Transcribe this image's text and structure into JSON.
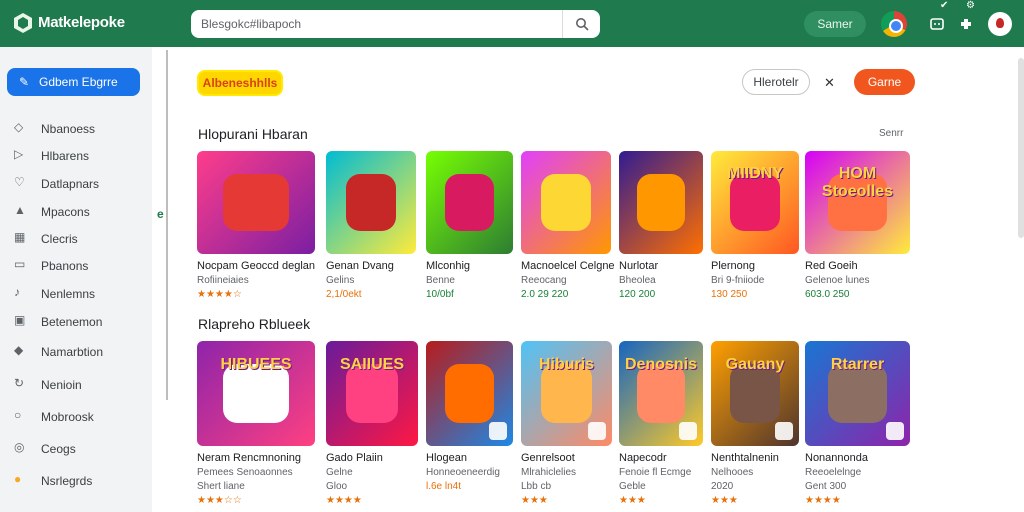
{
  "header": {
    "app_title": "Matkelepoke",
    "search_placeholder": "Blesgokc#libapoch",
    "sign_in": "Samer",
    "icons": [
      "search-icon",
      "chrome-icon",
      "extension-icon",
      "puzzle-icon",
      "avatar"
    ],
    "top_right_glyphs": [
      "✔",
      "⚙"
    ]
  },
  "sidebar": {
    "primary": "Gdbem Ebgrre",
    "items": [
      {
        "label": "Nbanoess",
        "icon": "tag-icon"
      },
      {
        "label": "Hlbarens",
        "icon": "play-icon"
      },
      {
        "label": "Datlapnars",
        "icon": "heart-icon"
      },
      {
        "label": "Mpacons",
        "icon": "mountain-icon"
      },
      {
        "label": "Clecris",
        "icon": "grid-icon"
      },
      {
        "label": "Pbanons",
        "icon": "book-icon"
      },
      {
        "label": "Nenlemns",
        "icon": "music-icon"
      },
      {
        "label": "Betenemon",
        "icon": "image-icon"
      },
      {
        "label": "Namarbtion",
        "icon": "tag-filled-icon"
      },
      {
        "label": "Nenioin",
        "icon": "refresh-icon"
      },
      {
        "label": "Mobroosk",
        "icon": "bulb-icon"
      },
      {
        "label": "Ceogs",
        "icon": "circle-icon"
      },
      {
        "label": "Nsrlegrds",
        "icon": "emoji-icon"
      }
    ]
  },
  "main": {
    "brand_badge": "Albeneshhlls",
    "outline_button": "Hlerotelr",
    "action_button": "Garne",
    "sections": [
      {
        "title": "Hlopurani Hbaran",
        "see_more": "Senrr",
        "cards": [
          {
            "title": "Nocpam Geoccd deglan",
            "sub": "Rofiineiaies",
            "meta": "★★★★☆",
            "meta_color": "orange",
            "bg": [
              "#ff3d8b",
              "#7b1fa2"
            ],
            "art": "#e53935"
          },
          {
            "title": "Genan Dvang",
            "sub": "Gelins",
            "meta": "2,1/0ekt",
            "meta_color": "orange",
            "bg": [
              "#00bcd4",
              "#ffeb3b"
            ],
            "art": "#c62828"
          },
          {
            "title": "Mlconhig",
            "sub": "Benne",
            "meta": "10/0bf",
            "meta_color": "green",
            "bg": [
              "#76ff03",
              "#2e7d32"
            ],
            "art": "#d81b60"
          },
          {
            "title": "Macnoelcel Celgne",
            "sub": "Reeocang",
            "meta": "2.0 29 220",
            "meta_color": "green",
            "bg": [
              "#e040fb",
              "#ff9800"
            ],
            "art": "#fdd835"
          },
          {
            "title": "Nurlotar",
            "sub": "Bheolea",
            "meta": "120 200",
            "meta_color": "green",
            "bg": [
              "#311b92",
              "#ff6f00"
            ],
            "art": "#ff9800"
          },
          {
            "title": "Plernong",
            "sub": "Bri 9-fniiode",
            "meta": "130 250",
            "meta_color": "orange",
            "bg": [
              "#ffeb3b",
              "#ff5722"
            ],
            "art": "#e91e63",
            "label": "MIIDNY"
          },
          {
            "title": "Red Goeih",
            "sub": "Gelenoe lunes",
            "meta": "603.0 250",
            "meta_color": "green",
            "bg": [
              "#d500f9",
              "#ffeb3b"
            ],
            "art": "#ff7043",
            "label": "HOM Stoeolles"
          }
        ]
      },
      {
        "title": "Rlapreho Rblueek",
        "cards": [
          {
            "title": "Neram Rencmnoning",
            "sub": "Pemees Senoaonnes",
            "meta": "Shert liane",
            "meta_color": "grey",
            "meta2": "★★★☆☆",
            "bg": [
              "#8e24aa",
              "#ff4081"
            ],
            "art": "#ffffff",
            "label": "HIBUEES"
          },
          {
            "title": "Gado Plaiin",
            "sub": "Gelne",
            "meta": "Gloo",
            "meta_color": "grey",
            "meta2": "★★★★",
            "bg": [
              "#6a1b9a",
              "#ff1744"
            ],
            "art": "#ff4081",
            "label": "SAIIUES"
          },
          {
            "title": "Hlogean",
            "sub": "Honneoeneerdig",
            "meta": "l.6e ln4t",
            "meta_color": "orange",
            "bg": [
              "#b71c1c",
              "#1e88e5"
            ],
            "art": "#ff6d00"
          },
          {
            "title": "Genrelsoot",
            "sub": "Mlrahiclelies",
            "meta": "Lbb  cb",
            "meta_color": "grey",
            "meta2": "★★★",
            "bg": [
              "#4fc3f7",
              "#ff8a65"
            ],
            "art": "#ffb74d",
            "label": "Hiburis"
          },
          {
            "title": "Napecodr",
            "sub": "Fenoie fl Ecmge",
            "meta": "Geble",
            "meta_color": "grey",
            "meta2": "★★★",
            "bg": [
              "#1565c0",
              "#ffca28"
            ],
            "art": "#ff8a65",
            "label": "Denosnis"
          },
          {
            "title": "Nenthtalnenin",
            "sub": "Nelhooes",
            "meta": "2020",
            "meta_color": "grey",
            "meta2": "★★★",
            "bg": [
              "#ffa000",
              "#4e342e"
            ],
            "art": "#795548",
            "label": "Gauany"
          },
          {
            "title": "Nonannonda",
            "sub": "Reeoelelnge",
            "meta": "Gent 300",
            "meta_color": "grey",
            "meta2": "★★★★",
            "bg": [
              "#1976d2",
              "#8e24aa"
            ],
            "art": "#8d6e63",
            "label": "Rtarrer"
          }
        ]
      }
    ]
  }
}
